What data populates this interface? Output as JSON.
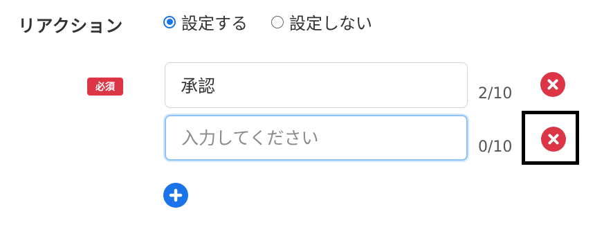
{
  "field": {
    "label": "リアクション"
  },
  "reaction_setting": {
    "options": [
      {
        "label": "設定する",
        "checked": true
      },
      {
        "label": "設定しない",
        "checked": false
      }
    ]
  },
  "required_badge": "必須",
  "reactions": [
    {
      "value": "承認",
      "placeholder": "",
      "counter": "2/10"
    },
    {
      "value": "",
      "placeholder": "入力してください",
      "counter": "0/10"
    }
  ],
  "icons": {
    "remove": "remove-circle-icon",
    "add": "add-circle-icon"
  },
  "colors": {
    "danger": "#dc3545",
    "primary": "#1a73e8",
    "focus_border": "#8ec2f5"
  }
}
